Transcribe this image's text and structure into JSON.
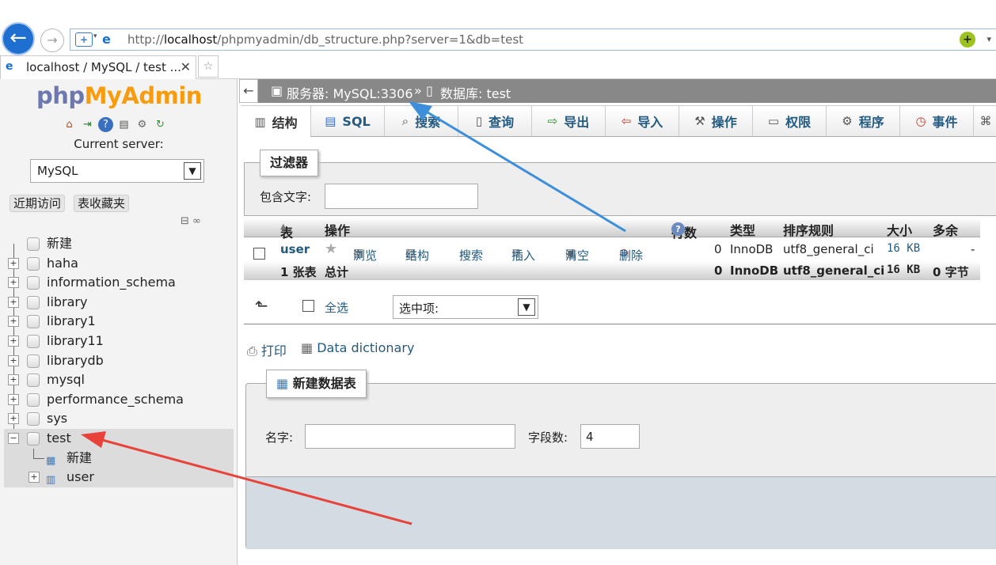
{
  "browser": {
    "url_prefix": "http://",
    "url_host": "localhost",
    "url_path": "/phpmyadmin/db_structure.php?server=1&db=test",
    "tab_title": "localhost / MySQL / test ..."
  },
  "nav": {
    "logo_php": "php",
    "logo_myadmin": "MyAdmin",
    "current_server_label": "Current server:",
    "server_selected": "MySQL",
    "recent_tab": "近期访问",
    "favorites_tab": "表收藏夹",
    "tree": [
      {
        "label": "新建"
      },
      {
        "label": "haha"
      },
      {
        "label": "information_schema"
      },
      {
        "label": "library"
      },
      {
        "label": "library1"
      },
      {
        "label": "library11"
      },
      {
        "label": "librarydb"
      },
      {
        "label": "mysql"
      },
      {
        "label": "performance_schema"
      },
      {
        "label": "sys"
      },
      {
        "label": "test"
      }
    ],
    "test_children": [
      {
        "label": "新建"
      },
      {
        "label": "user"
      }
    ]
  },
  "breadcrumb": {
    "server": "服务器: MySQL:3306",
    "sep": "»",
    "database": "数据库: test"
  },
  "tabs": [
    "结构",
    "SQL",
    "搜索",
    "查询",
    "导出",
    "导入",
    "操作",
    "权限",
    "程序",
    "事件"
  ],
  "filter": {
    "legend": "过滤器",
    "label": "包含文字:",
    "value": ""
  },
  "table": {
    "headers": {
      "table": "表",
      "action": "操作",
      "rows": "行数",
      "type": "类型",
      "collation": "排序规则",
      "size": "大小",
      "overhead": "多余"
    },
    "rows": [
      {
        "name": "user",
        "actions": [
          "浏览",
          "结构",
          "搜索",
          "插入",
          "清空",
          "删除"
        ],
        "row_count": "0",
        "type": "InnoDB",
        "collation": "utf8_general_ci",
        "size": "16 KB",
        "overhead": "-"
      }
    ],
    "footer": {
      "count": "1 张表",
      "total": "总计",
      "rows": "0",
      "type": "InnoDB",
      "collation": "utf8_general_ci",
      "size": "16 KB",
      "overhead": "0 字节"
    }
  },
  "bulk": {
    "select_all": "全选",
    "with_selected": "选中项:"
  },
  "links": {
    "print": "打印",
    "data_dictionary": "Data dictionary"
  },
  "create": {
    "legend": "新建数据表",
    "name_label": "名字:",
    "name_value": "",
    "cols_label": "字段数:",
    "cols_value": "4"
  },
  "colors": {
    "accent": "#235a81",
    "logo_php": "#6c78af",
    "logo_myadmin": "#f89c0e",
    "breadcrumb_bg": "#888888",
    "annotation_blue": "#3d8fdc",
    "annotation_red": "#e8423a"
  }
}
